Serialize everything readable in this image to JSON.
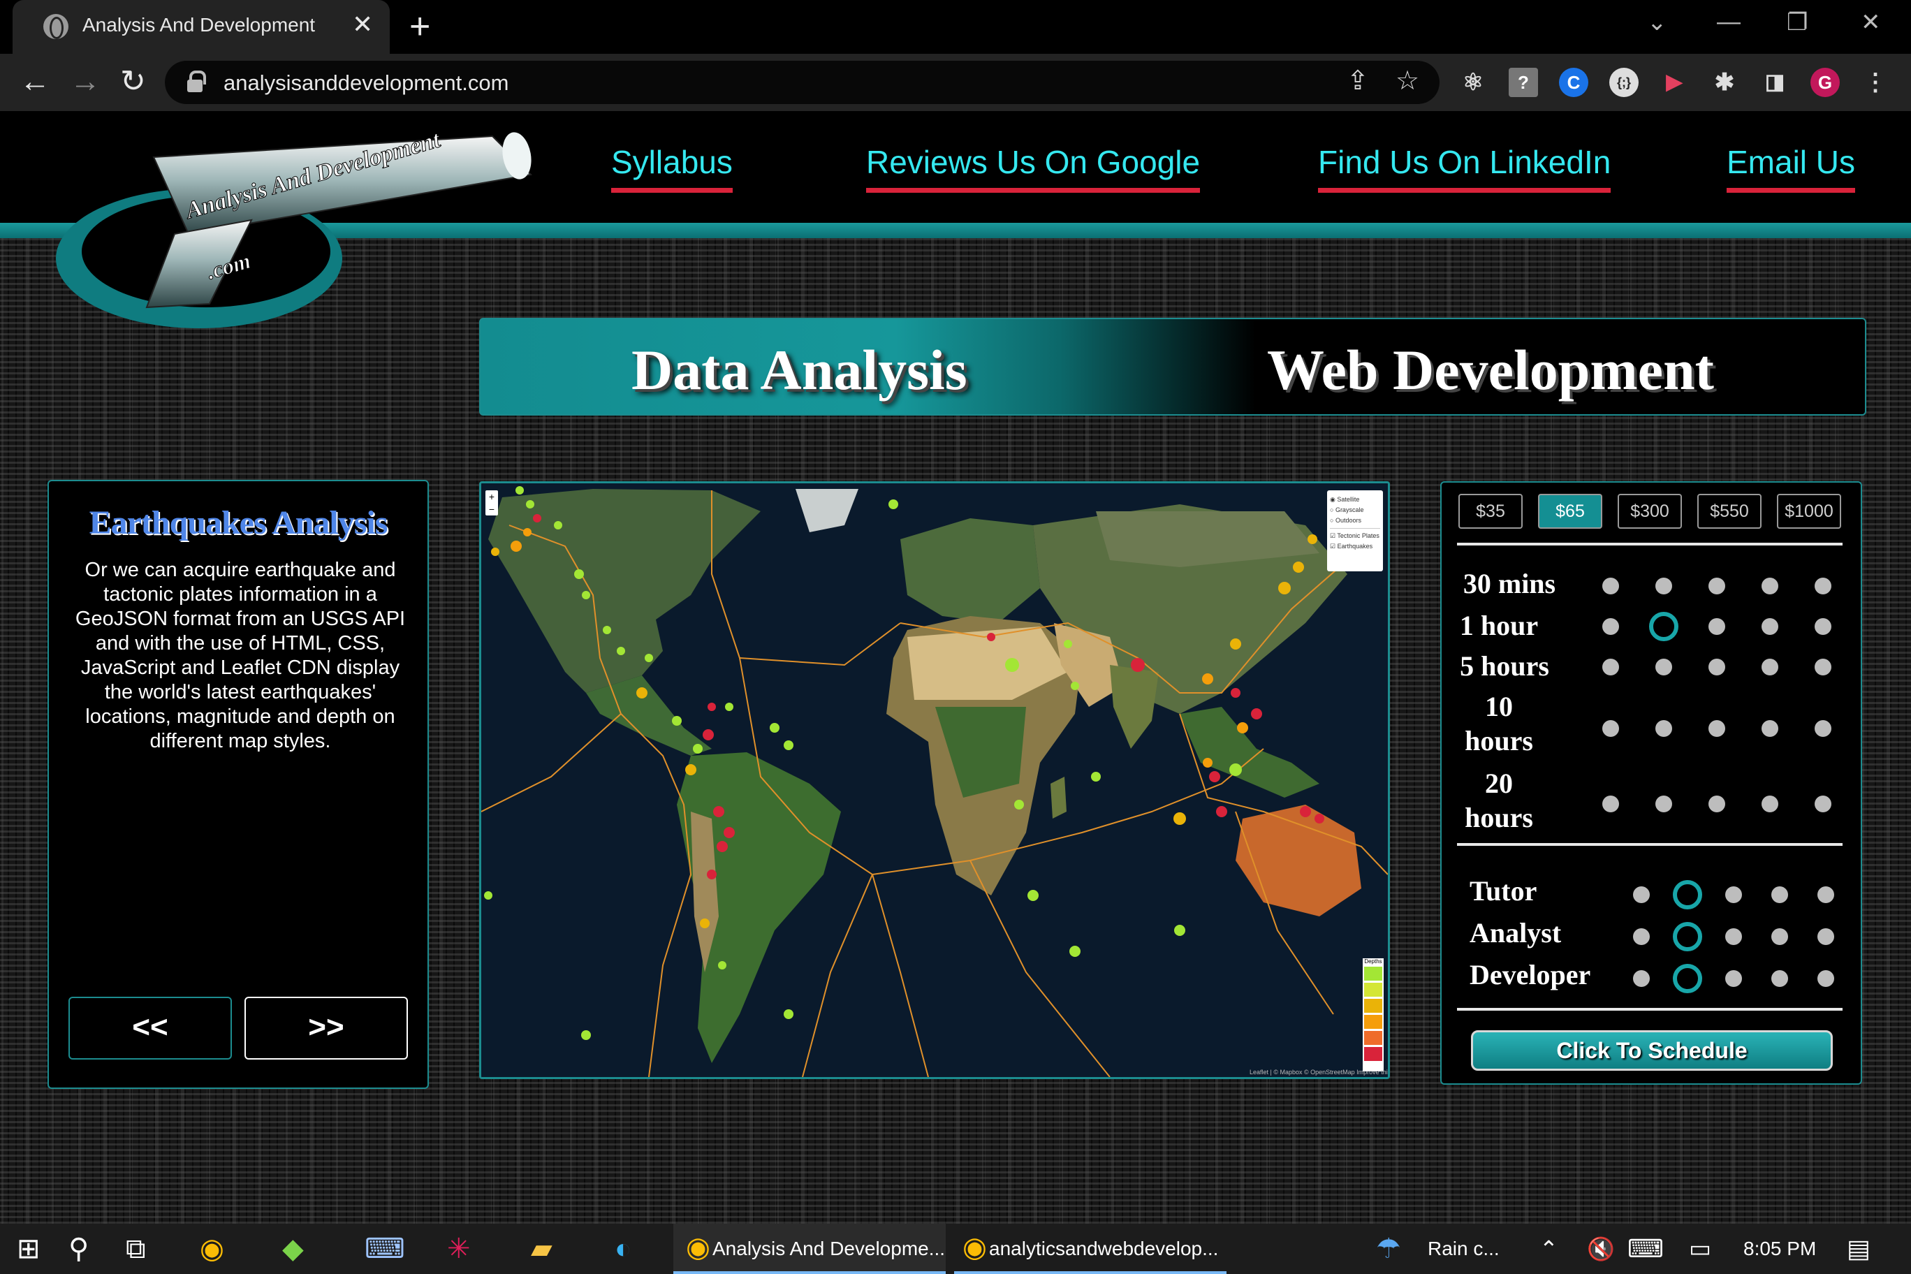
{
  "browser": {
    "tab_title": "Analysis And Development",
    "tab_close": "✕",
    "new_tab": "+",
    "url": "analysisanddevelopment.com",
    "window_controls": [
      "⌄",
      "—",
      "❐",
      "✕"
    ]
  },
  "site": {
    "logo_line1": "Analysis And Development",
    "logo_line2": ".com",
    "nav": [
      "Syllabus",
      "Reviews Us On Google",
      "Find Us On LinkedIn",
      "Email Us"
    ],
    "banner_left": "Data Analysis",
    "banner_right": "Web Development",
    "accent_color": "#1c8c8f",
    "link_color": "#35e8f0",
    "underline_color": "#d9233a"
  },
  "project_card": {
    "title": "Earthquakes Analysis",
    "body": "Or we can acquire earthquake and tactonic plates information in a GeoJSON format from an USGS API and with the use of HTML, CSS, JavaScript and Leaflet CDN display the world's latest earthquakes' locations, magnitude and depth on different map styles.",
    "prev_label": "<<",
    "next_label": ">>"
  },
  "map": {
    "zoom_in": "+",
    "zoom_out": "−",
    "base_layers": [
      "Satellite",
      "Grayscale",
      "Outdoors"
    ],
    "selected_base_layer": "Satellite",
    "overlays": [
      "Tectonic Plates",
      "Earthquakes"
    ],
    "legend_title": "Depths",
    "attribution": "Leaflet | © Mapbox © OpenStreetMap Improve this map"
  },
  "pricing": {
    "price_tabs": [
      "$35",
      "$65",
      "$300",
      "$550",
      "$1000"
    ],
    "selected_price": "$65",
    "durations": [
      "30 mins",
      "1 hour",
      "5 hours",
      "10 hours",
      "20 hours"
    ],
    "selected_duration": {
      "row": 1,
      "column": 1
    },
    "roles": [
      "Tutor",
      "Analyst",
      "Developer"
    ],
    "selected_role_column": 1,
    "schedule_label": "Click To Schedule"
  },
  "taskbar": {
    "open_apps": [
      "Analysis And Developme...",
      "analyticsandwebdevelop..."
    ],
    "weather": "Rain c...",
    "time": "8:05 PM"
  }
}
